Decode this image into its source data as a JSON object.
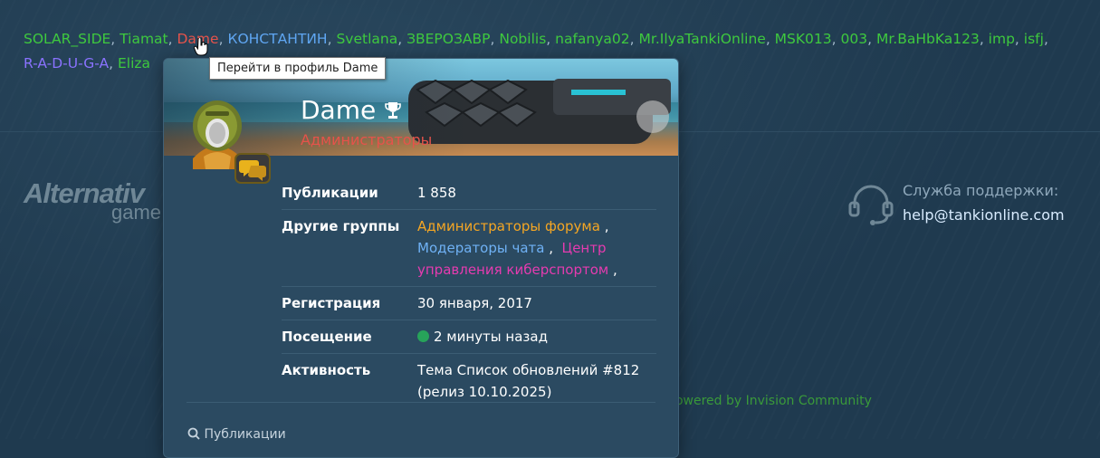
{
  "online_users": [
    {
      "name": "SOLAR_SIDE",
      "color": "#3ec93e"
    },
    {
      "name": "Tiamat",
      "color": "#3ec93e"
    },
    {
      "name": "Dame",
      "color": "#e5534b"
    },
    {
      "name": "КОНСТАНТИН",
      "color": "#5fa6f2"
    },
    {
      "name": "Svetlana",
      "color": "#3ec93e"
    },
    {
      "name": "ЗВЕРОЗАВР",
      "color": "#3ec93e"
    },
    {
      "name": "Nobilis",
      "color": "#3ec93e"
    },
    {
      "name": "nafanya02",
      "color": "#3ec93e"
    },
    {
      "name": "Mr.IlyaTankiOnline",
      "color": "#3ec93e"
    },
    {
      "name": "MSK013",
      "color": "#3ec93e"
    },
    {
      "name": "003",
      "color": "#3ec93e"
    },
    {
      "name": "Mr.BaHbKa123",
      "color": "#3ec93e"
    },
    {
      "name": "imp",
      "color": "#3ec93e"
    },
    {
      "name": "isfj",
      "color": "#3ec93e"
    },
    {
      "name": "R-A-D-U-G-A",
      "color": "#8a72ff"
    },
    {
      "name": "Eliza",
      "color": "#3ec93e"
    }
  ],
  "tooltip": "Перейти в профиль Dame",
  "footer": {
    "logo_main": "Alternativ",
    "logo_sub": "game",
    "support_label": "Служба поддержки:",
    "support_email": "help@tankionline.com",
    "powered": "Powered by Invision Community"
  },
  "card": {
    "username": "Dame",
    "group": "Администраторы",
    "rows": {
      "posts_label": "Публикации",
      "posts_value": "1 858",
      "groups_label": "Другие группы",
      "groups": [
        "Администраторы форума",
        "Модераторы чата",
        "Центр управления киберспортом"
      ],
      "reg_label": "Регистрация",
      "reg_value": "30 января, 2017",
      "visit_label": "Посещение",
      "visit_value": "2 минуты назад",
      "activity_label": "Активность",
      "activity_value": "Тема Список обновлений #812 (релиз 10.10.2025)"
    },
    "footer_link": "Публикации"
  },
  "colors": {
    "admin": "#e5534b",
    "online_green": "#3ec93e",
    "forum_admin": "#f5a623",
    "chat_mod": "#6fb1f5",
    "esports": "#e63bb0"
  }
}
